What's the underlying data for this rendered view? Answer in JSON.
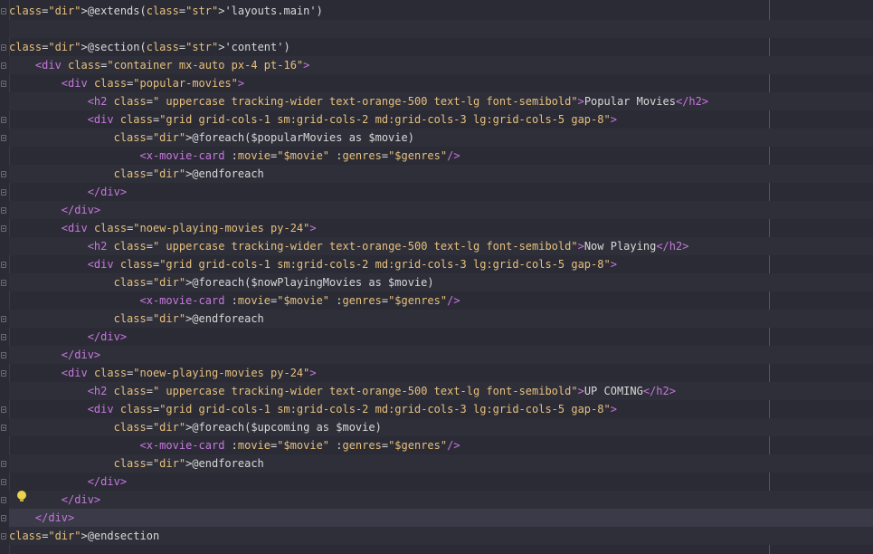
{
  "lines": [
    "@extends('layouts.main')",
    "",
    "@section('content')",
    "    <div class=\"container mx-auto px-4 pt-16\">",
    "        <div class=\"popular-movies\">",
    "            <h2 class=\" uppercase tracking-wider text-orange-500 text-lg font-semibold\">Popular Movies</h2>",
    "            <div class=\"grid grid-cols-1 sm:grid-cols-2 md:grid-cols-3 lg:grid-cols-5 gap-8\">",
    "                @foreach($popularMovies as $movie)",
    "                    <x-movie-card :movie=\"$movie\" :genres=\"$genres\"/>",
    "                @endforeach",
    "            </div>",
    "        </div>",
    "        <div class=\"noew-playing-movies py-24\">",
    "            <h2 class=\" uppercase tracking-wider text-orange-500 text-lg font-semibold\">Now Playing</h2>",
    "            <div class=\"grid grid-cols-1 sm:grid-cols-2 md:grid-cols-3 lg:grid-cols-5 gap-8\">",
    "                @foreach($nowPlayingMovies as $movie)",
    "                    <x-movie-card :movie=\"$movie\" :genres=\"$genres\"/>",
    "                @endforeach",
    "            </div>",
    "        </div>",
    "        <div class=\"noew-playing-movies py-24\">",
    "            <h2 class=\" uppercase tracking-wider text-orange-500 text-lg font-semibold\">UP COMING</h2>",
    "            <div class=\"grid grid-cols-1 sm:grid-cols-2 md:grid-cols-3 lg:grid-cols-5 gap-8\">",
    "                @foreach($upcoming as $movie)",
    "                    <x-movie-card :movie=\"$movie\" :genres=\"$genres\"/>",
    "                @endforeach",
    "            </div>",
    "        </div>",
    "    </div>",
    "@endsection"
  ],
  "current_line": 28,
  "icons": {
    "intention": "lightbulb-icon",
    "fold": "fold-marker-icon"
  },
  "colors": {
    "background": "#2b2b36",
    "directive": "#c678dd",
    "string": "#e6c07b",
    "tag": "#c678dd",
    "text": "#b5b5ff",
    "attribute": "#e5c07b"
  }
}
